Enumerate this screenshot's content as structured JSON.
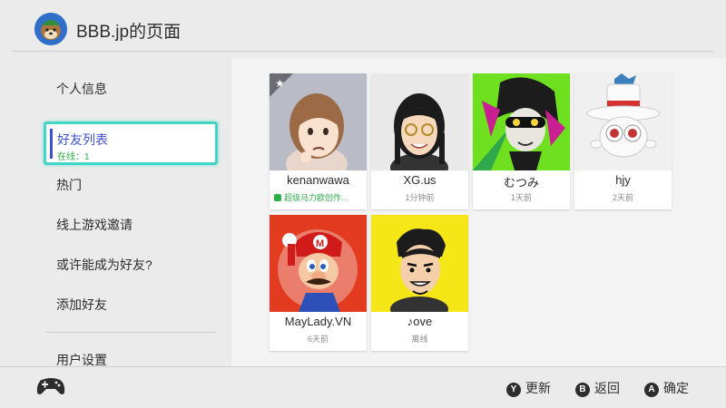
{
  "header": {
    "title": "BBB.jp的页面"
  },
  "sidebar": {
    "items": [
      {
        "label": "个人信息"
      },
      {
        "label": "好友列表",
        "sub": "在线：1"
      },
      {
        "label": "热门"
      },
      {
        "label": "线上游戏邀请"
      },
      {
        "label": "或许能成为好友?"
      },
      {
        "label": "添加好友"
      },
      {
        "label": "用户设置"
      }
    ]
  },
  "friends": [
    {
      "name": "kenanwawa",
      "status": "超级马力欧创作…",
      "online": true,
      "favorite": true
    },
    {
      "name": "XG.us",
      "status": "1分钟前"
    },
    {
      "name": "むつみ",
      "status": "1天前"
    },
    {
      "name": "hjy",
      "status": "2天前"
    },
    {
      "name": "MayLady.VN",
      "status": "6天前"
    },
    {
      "name": "♪ove",
      "status": "离线"
    }
  ],
  "footer": {
    "buttons": [
      {
        "key": "Y",
        "label": "更新"
      },
      {
        "key": "B",
        "label": "返回"
      },
      {
        "key": "A",
        "label": "确定"
      }
    ]
  },
  "colors": {
    "accent": "#3d4fd8",
    "focus": "#3fd6c8",
    "online": "#2dae48"
  }
}
